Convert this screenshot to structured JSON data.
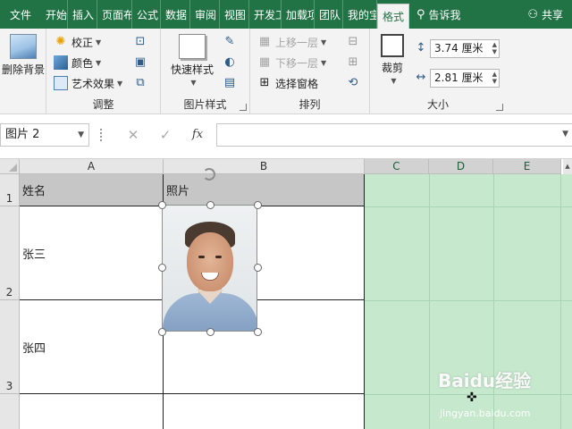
{
  "tabs": [
    "文件",
    "开始",
    "插入",
    "页面布",
    "公式",
    "数据",
    "审阅",
    "视图",
    "开发工",
    "加载项",
    "团队",
    "我的宝",
    "格式"
  ],
  "tell_me": "告诉我",
  "share": "共享",
  "ribbon": {
    "remove_bg": "删除背景",
    "adjust": {
      "correct": "校正",
      "color": "颜色",
      "art_effects": "艺术效果",
      "label": "调整"
    },
    "styles": {
      "quick_styles": "快速样式",
      "label": "图片样式"
    },
    "arrange": {
      "bring_forward": "上移一层",
      "send_backward": "下移一层",
      "selection_pane": "选择窗格",
      "label": "排列"
    },
    "size": {
      "crop": "裁剪",
      "height": "3.74 厘米",
      "width": "2.81 厘米",
      "label": "大小"
    }
  },
  "formula_bar": {
    "name_box": "图片 2",
    "fx": "fx",
    "cancel": "✕",
    "enter": "✓"
  },
  "grid": {
    "columns": [
      "A",
      "B",
      "C",
      "D",
      "E"
    ],
    "rows": [
      "1",
      "2",
      "3"
    ],
    "cells": {
      "a1": "姓名",
      "b1": "照片",
      "a2": "张三",
      "a3": "张四"
    }
  },
  "colors": {
    "accent": "#217346",
    "selection_fill": "#c6e9cd"
  },
  "watermark": {
    "logo": "Baidu经验",
    "url": "jingyan.baidu.com"
  }
}
